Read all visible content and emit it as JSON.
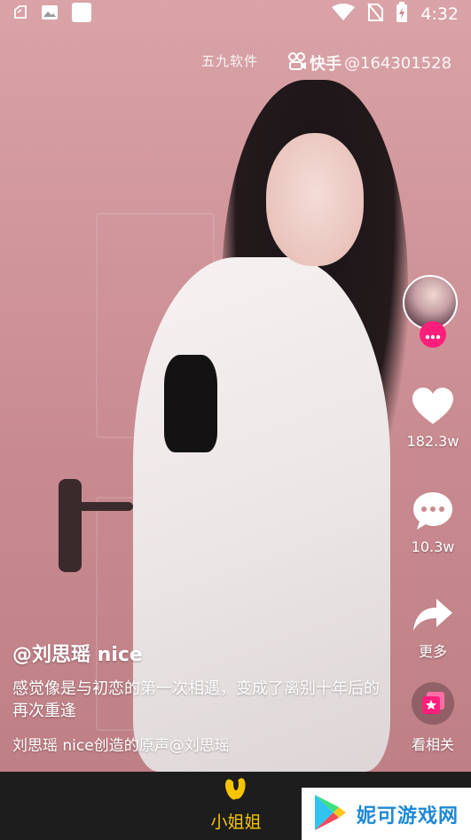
{
  "status_bar": {
    "time": "4:32"
  },
  "watermark": {
    "left_text": "五九软件",
    "app_name": "快手",
    "user_id": "@164301528"
  },
  "creator": {
    "avatar": "creator-avatar",
    "follow_badge": "more-dots-icon"
  },
  "actions": {
    "like": {
      "count": "182.3w"
    },
    "comment": {
      "count": "10.3w"
    },
    "share": {
      "label": "更多"
    },
    "related": {
      "label": "看相关"
    }
  },
  "caption": {
    "author": "@刘思瑶 nice",
    "description": "感觉像是与初恋的第一次相遇，变成了离别十年后的再次重逢",
    "music": "刘思瑶 nice创造的原声@刘思瑶"
  },
  "bottom_nav": {
    "tab_label": "小姐姐"
  },
  "brand": {
    "text": "妮可游戏网"
  },
  "colors": {
    "accent": "#ff1f7a",
    "tab_active": "#f6c400",
    "nav_bg": "#1d1d1d",
    "brand_blue": "#1e88d6"
  }
}
